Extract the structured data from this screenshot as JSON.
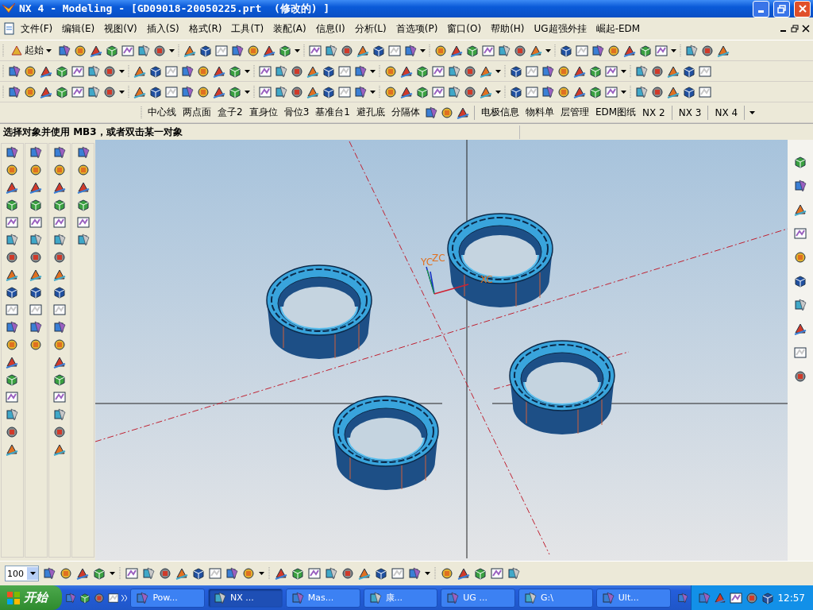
{
  "window": {
    "title": "NX 4 - Modeling - [GD09018-20050225.prt  (修改的) ]"
  },
  "menu": [
    "文件(F)",
    "编辑(E)",
    "视图(V)",
    "插入(S)",
    "格式(R)",
    "工具(T)",
    "装配(A)",
    "信息(I)",
    "分析(L)",
    "首选项(P)",
    "窗口(O)",
    "帮助(H)",
    "UG超强外挂",
    "崛起-EDM"
  ],
  "standard_toolbar": {
    "start_button": "起始"
  },
  "custom_toolbar": [
    "中心线",
    "两点面",
    "盒子2",
    "直身位",
    "骨位3",
    "基准台1",
    "避孔底",
    "分隔体"
  ],
  "electrode_toolbar": [
    "电极信息",
    "物料单",
    "层管理",
    "EDM图纸",
    "NX 2",
    "NX 3",
    "NX 4"
  ],
  "prompt": "选择对象并使用 MB3，或者双击某一对象",
  "viewport": {
    "axis_labels": [
      "YC",
      "ZC",
      "XC"
    ]
  },
  "zoom": {
    "value": "100"
  },
  "taskbar": {
    "start": "开始",
    "tasks": [
      {
        "label": "Pow...",
        "selected": false
      },
      {
        "label": "NX ...",
        "selected": true
      },
      {
        "label": "Mas...",
        "selected": false
      },
      {
        "label": "康...",
        "selected": false
      },
      {
        "label": "UG ...",
        "selected": false
      },
      {
        "label": "G:\\",
        "selected": false
      },
      {
        "label": "Ult...",
        "selected": false
      }
    ],
    "clock": "12:57"
  }
}
